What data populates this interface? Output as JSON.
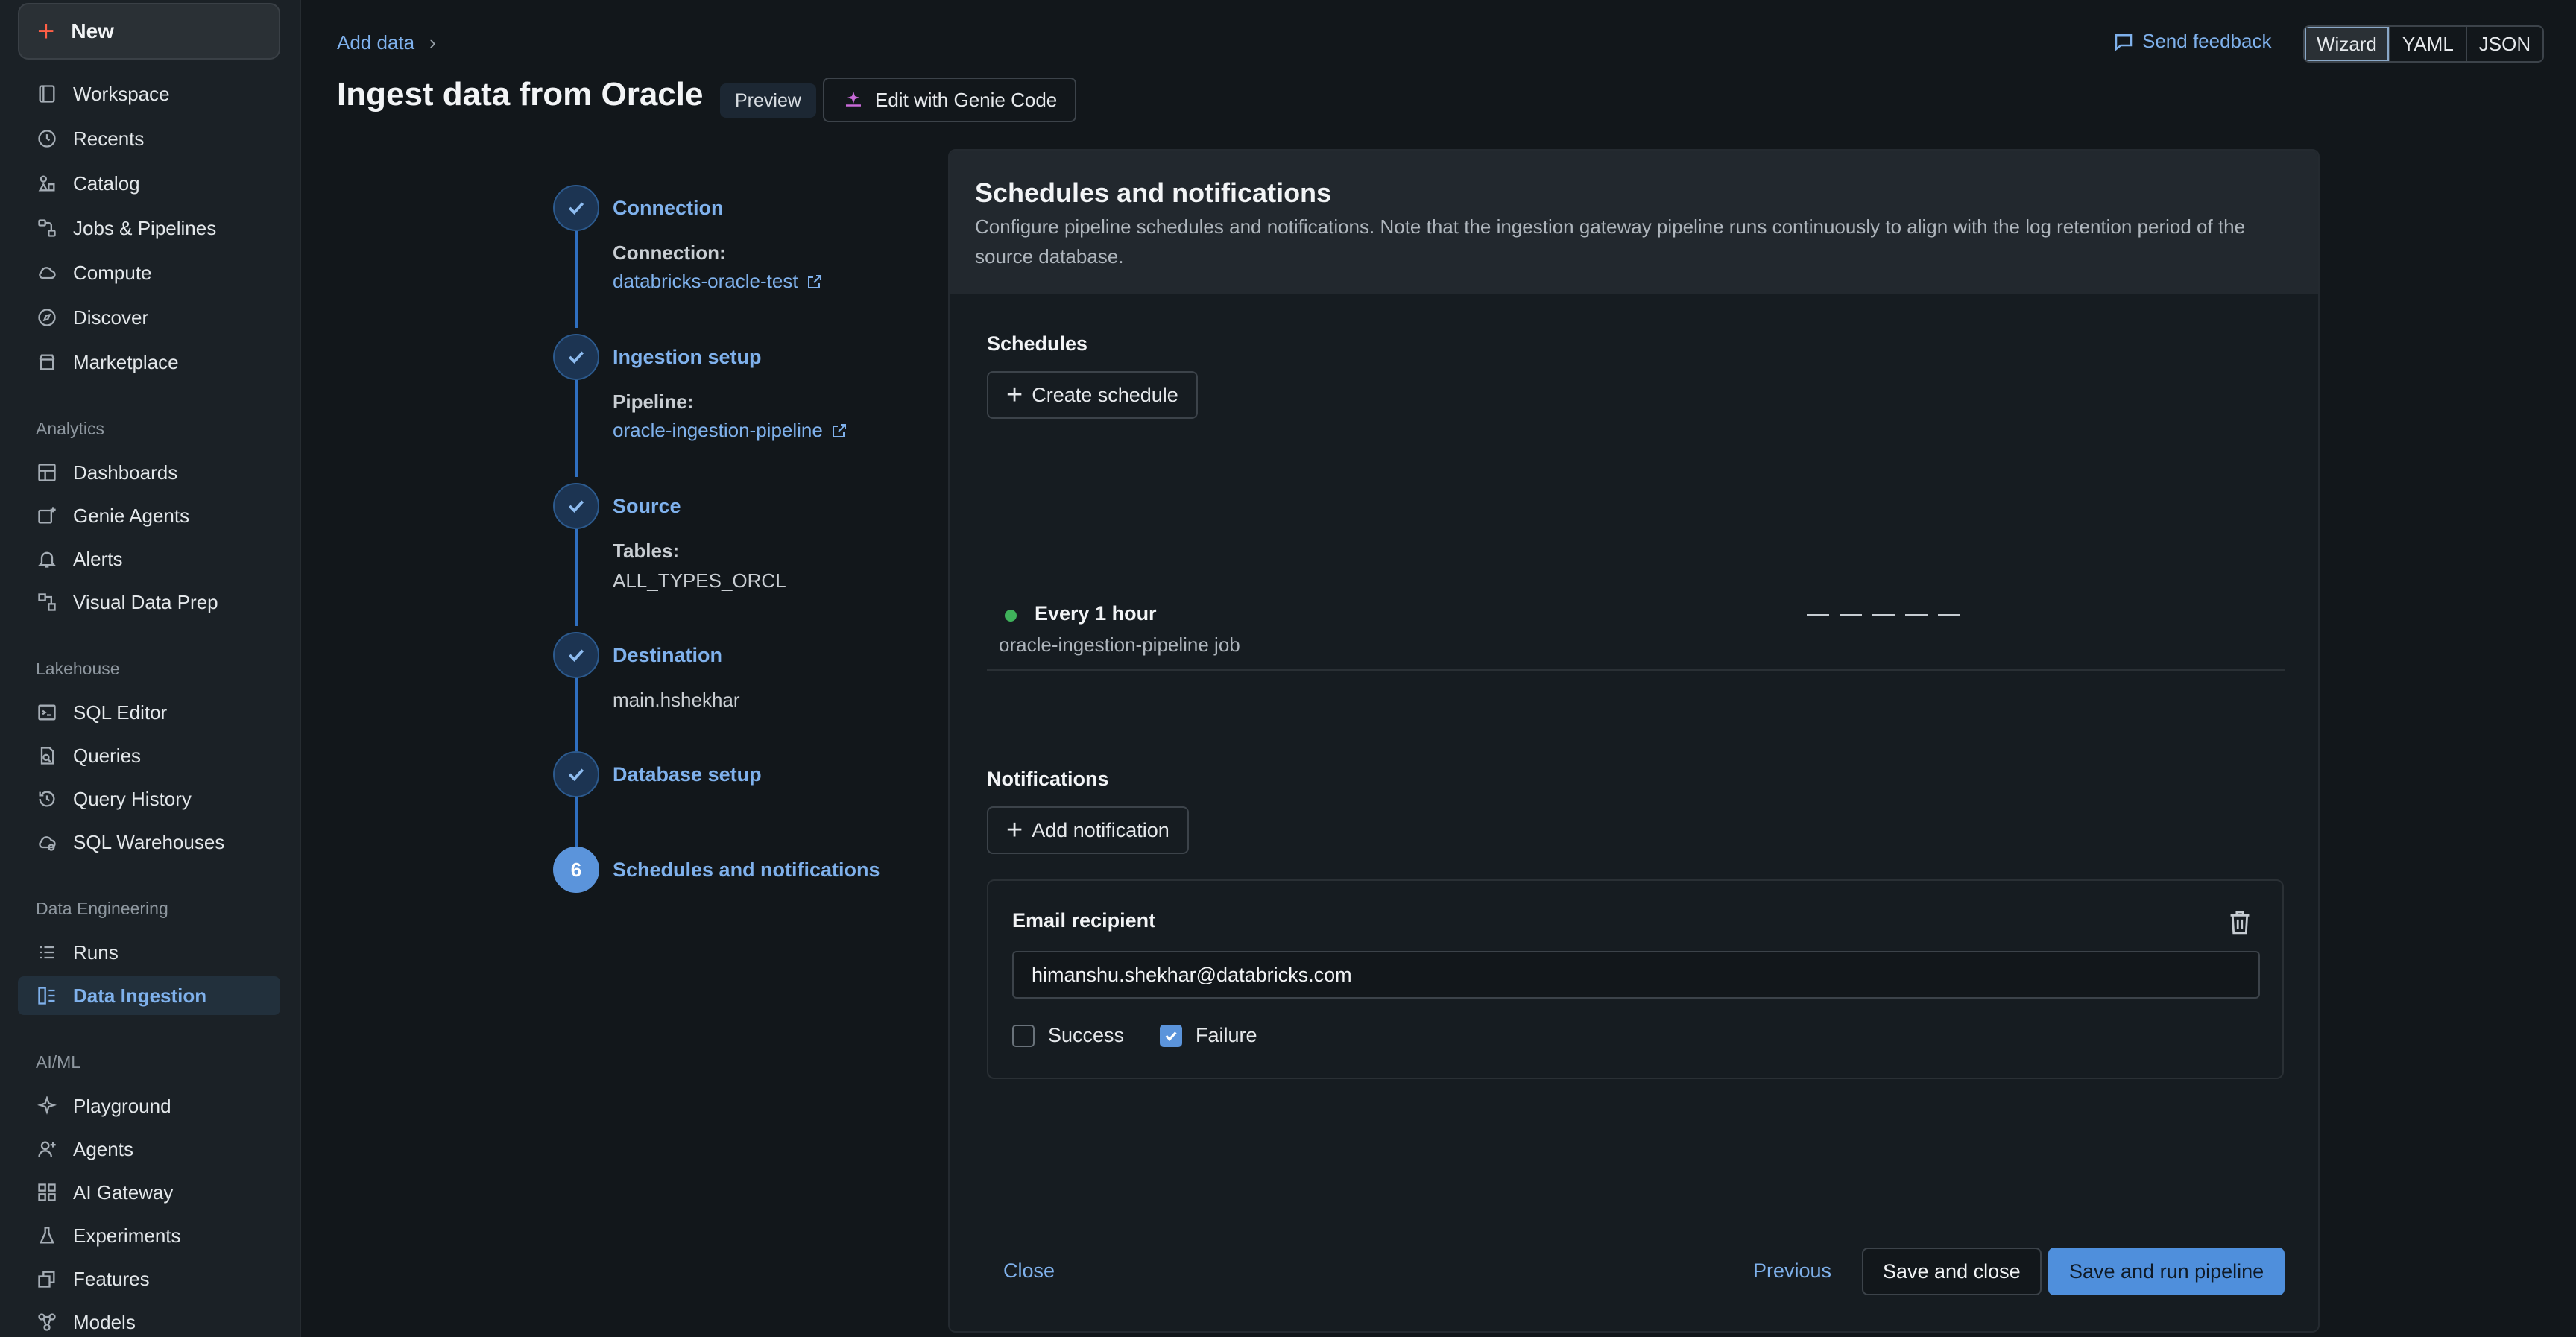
{
  "sidebar": {
    "new_label": "New",
    "items_main": [
      {
        "label": "Workspace",
        "icon": "workspace-icon"
      },
      {
        "label": "Recents",
        "icon": "clock-icon"
      },
      {
        "label": "Catalog",
        "icon": "catalog-icon"
      },
      {
        "label": "Jobs & Pipelines",
        "icon": "jobs-icon"
      },
      {
        "label": "Compute",
        "icon": "cloud-icon"
      },
      {
        "label": "Discover",
        "icon": "compass-icon"
      },
      {
        "label": "Marketplace",
        "icon": "store-icon"
      }
    ],
    "section_analytics": "Analytics",
    "items_analytics": [
      {
        "label": "Dashboards",
        "icon": "dashboard-icon"
      },
      {
        "label": "Genie Agents",
        "icon": "genie-icon"
      },
      {
        "label": "Alerts",
        "icon": "bell-icon"
      },
      {
        "label": "Visual Data Prep",
        "icon": "data-prep-icon"
      }
    ],
    "section_lakehouse": "Lakehouse",
    "items_lakehouse": [
      {
        "label": "SQL Editor",
        "icon": "sql-editor-icon"
      },
      {
        "label": "Queries",
        "icon": "queries-icon"
      },
      {
        "label": "Query History",
        "icon": "history-icon"
      },
      {
        "label": "SQL Warehouses",
        "icon": "warehouse-icon"
      }
    ],
    "section_data_engineering": "Data Engineering",
    "items_data_engineering": [
      {
        "label": "Runs",
        "icon": "runs-icon"
      },
      {
        "label": "Data Ingestion",
        "icon": "ingestion-icon",
        "active": true
      }
    ],
    "section_aiml": "AI/ML",
    "items_aiml": [
      {
        "label": "Playground",
        "icon": "sparkle-icon"
      },
      {
        "label": "Agents",
        "icon": "agents-icon"
      },
      {
        "label": "AI Gateway",
        "icon": "gateway-icon"
      },
      {
        "label": "Experiments",
        "icon": "flask-icon"
      },
      {
        "label": "Features",
        "icon": "features-icon"
      },
      {
        "label": "Models",
        "icon": "models-icon"
      }
    ]
  },
  "header": {
    "breadcrumb": "Add data",
    "title": "Ingest data from Oracle",
    "badge": "Preview",
    "genie_button": "Edit with Genie Code",
    "feedback": "Send feedback",
    "modes": [
      "Wizard",
      "YAML",
      "JSON"
    ],
    "active_mode": "Wizard"
  },
  "steps": {
    "connection": {
      "title": "Connection",
      "label": "Connection:",
      "value": "databricks-oracle-test"
    },
    "ingestion": {
      "title": "Ingestion setup",
      "label": "Pipeline:",
      "value": "oracle-ingestion-pipeline"
    },
    "source": {
      "title": "Source",
      "label": "Tables:",
      "value": "ALL_TYPES_ORCL"
    },
    "destination": {
      "title": "Destination",
      "value": "main.hshekhar"
    },
    "database": {
      "title": "Database setup"
    },
    "schedules": {
      "number": "6",
      "title": "Schedules and notifications"
    }
  },
  "panel": {
    "title": "Schedules and notifications",
    "description": "Configure pipeline schedules and notifications. Note that the ingestion gateway pipeline runs continuously to align with the log retention period of the source database.",
    "schedules_title": "Schedules",
    "create_schedule": "Create schedule",
    "schedule": {
      "title": "Every 1 hour",
      "subtitle": "oracle-ingestion-pipeline job",
      "status_color": "#3fb25b"
    },
    "notifications_title": "Notifications",
    "add_notification": "Add notification",
    "email_label": "Email recipient",
    "email_value": "himanshu.shekhar@databricks.com",
    "success_label": "Success",
    "success_checked": false,
    "failure_label": "Failure",
    "failure_checked": true
  },
  "footer": {
    "close": "Close",
    "previous": "Previous",
    "save_close": "Save and close",
    "save_run": "Save and run pipeline"
  },
  "colors": {
    "accent": "#4f8fdc",
    "link": "#7fb1ec",
    "new_plus": "#ff5f46"
  }
}
